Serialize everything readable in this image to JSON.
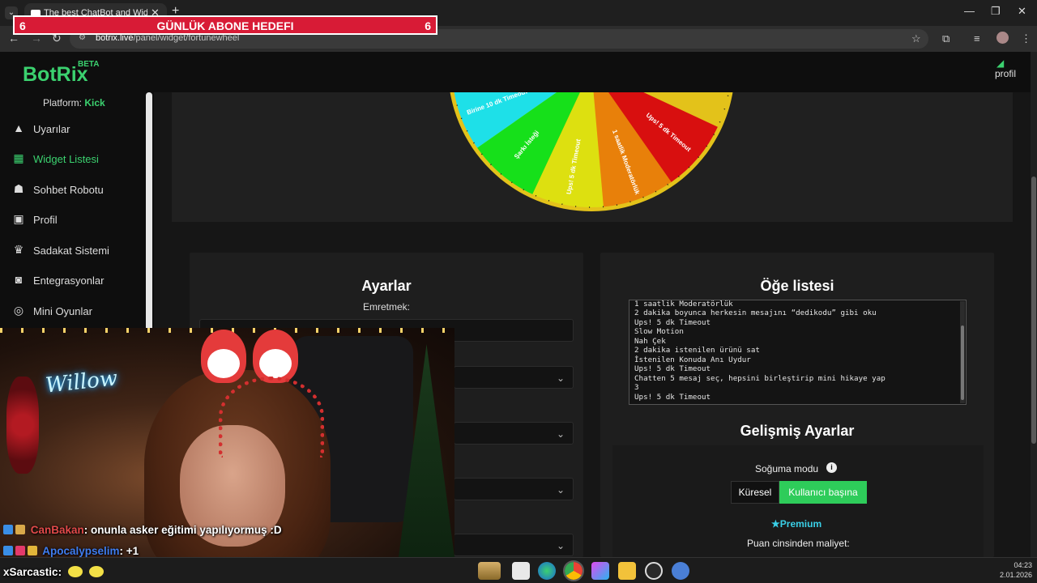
{
  "browser": {
    "tab_title": "The best ChatBot and Widgets",
    "url_host": "botrix.live",
    "url_path": "/panel/widget/fortunewheel"
  },
  "overlay_banner": {
    "left_count": "6",
    "title": "GÜNLÜK ABONE HEDEFI",
    "right_count": "6"
  },
  "app": {
    "logo": "BotRix",
    "beta": "BETA",
    "profile_label": "profil"
  },
  "sidebar": {
    "platform_label": "Platform:",
    "platform_value": "Kick",
    "items": [
      {
        "label": "Uyarılar",
        "icon": "warning-icon"
      },
      {
        "label": "Widget Listesi",
        "icon": "grid-icon"
      },
      {
        "label": "Sohbet Robotu",
        "icon": "robot-icon"
      },
      {
        "label": "Profil",
        "icon": "id-card-icon"
      },
      {
        "label": "Sadakat Sistemi",
        "icon": "trophy-icon"
      },
      {
        "label": "Entegrasyonlar",
        "icon": "discord-icon"
      },
      {
        "label": "Mini Oyunlar",
        "icon": "gamepad-icon"
      }
    ]
  },
  "wheel": {
    "segments": [
      {
        "label": "",
        "color": "#1a3fd6"
      },
      {
        "label": "Birine 10 dk Timeout",
        "color": "#1ee0e8"
      },
      {
        "label": "Şarkı İsteği",
        "color": "#16e01a"
      },
      {
        "label": "Ups! 5 dk Timeout",
        "color": "#dde010"
      },
      {
        "label": "1 saatlik Moderatörlük",
        "color": "#e8800a"
      },
      {
        "label": "Ups! 5 dk Timeout",
        "color": "#d80f0f"
      }
    ]
  },
  "settings": {
    "title": "Ayarlar",
    "command_label": "Emretmek:"
  },
  "item_list": {
    "title": "Öğe listesi",
    "lines": [
      "1 saatlik Moderatörlük",
      "2 dakika boyunca herkesin mesajını “dedikodu” gibi oku",
      "Ups! 5 dk Timeout",
      "Slow Motion",
      "Nah Çek",
      "2 dakika istenilen ürünü sat",
      "İstenilen Konuda Anı Uydur",
      "Ups! 5 dk Timeout",
      "Chatten 5 mesaj seç, hepsini birleştirip mini hikaye yap",
      "3",
      "Ups! 5 dk Timeout"
    ]
  },
  "advanced": {
    "title": "Gelişmiş Ayarlar",
    "cooldown_label": "Soğuma modu",
    "option_global": "Küresel",
    "option_per_user": "Kullanıcı başına",
    "premium_label": "Premium",
    "cost_label": "Puan cinsinden maliyet:"
  },
  "webcam": {
    "neon_text": "Willow"
  },
  "chat": [
    {
      "user": "CanBakan",
      "message": ": onunla asker eğitimi yapılıyormuş :D",
      "color": "#e24a4a"
    },
    {
      "user": "Apocalypselim",
      "message": ": +1",
      "color": "#3f7df0"
    },
    {
      "user": "xSarcastic",
      "message": ":",
      "color": "#ffffff"
    }
  ],
  "taskbar": {
    "time": "04:23",
    "date": "2.01.2026"
  },
  "colors": {
    "accent": "#3bd16f",
    "banner": "#d81b36"
  }
}
